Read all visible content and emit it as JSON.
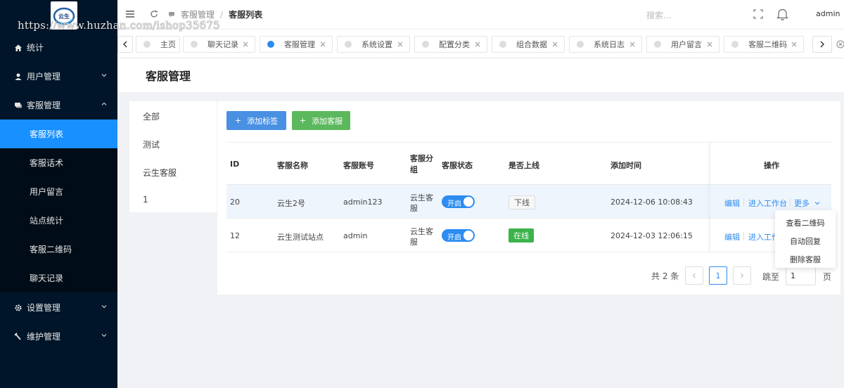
{
  "watermark": "https://www.huzhan.com/ishop35675",
  "logo_text": "云生",
  "sidebar": {
    "items": [
      {
        "label": "统计",
        "icon": "home-icon"
      },
      {
        "label": "用户管理",
        "icon": "user-icon",
        "expanded": false
      },
      {
        "label": "客服管理",
        "icon": "chat-icon",
        "expanded": true,
        "children": [
          {
            "label": "客服列表",
            "active": true
          },
          {
            "label": "客服话术"
          },
          {
            "label": "用户留言"
          },
          {
            "label": "站点统计"
          },
          {
            "label": "客服二维码"
          },
          {
            "label": "聊天记录"
          }
        ]
      },
      {
        "label": "设置管理",
        "icon": "gear-icon",
        "expanded": false
      },
      {
        "label": "维护管理",
        "icon": "wrench-icon",
        "expanded": false
      }
    ]
  },
  "topbar": {
    "breadcrumb": [
      "客服管理",
      "客服列表"
    ],
    "search_placeholder": "搜索...",
    "user": "admin"
  },
  "tabs": [
    {
      "label": "主页",
      "closable": false
    },
    {
      "label": "聊天记录",
      "closable": true
    },
    {
      "label": "客服管理",
      "closable": true,
      "active": true
    },
    {
      "label": "系统设置",
      "closable": true
    },
    {
      "label": "配置分类",
      "closable": true
    },
    {
      "label": "组合数据",
      "closable": true
    },
    {
      "label": "系统日志",
      "closable": true
    },
    {
      "label": "用户留言",
      "closable": true
    },
    {
      "label": "客服二维码",
      "closable": true
    }
  ],
  "page_title": "客服管理",
  "groups": [
    "全部",
    "测试",
    "云生客服",
    "1"
  ],
  "buttons": {
    "add_tag": "添加标签",
    "add_service": "添加客服"
  },
  "table": {
    "headers": [
      "ID",
      "客服名称",
      "客服账号",
      "客服分组",
      "客服状态",
      "是否上线",
      "添加时间",
      "操作"
    ],
    "rows": [
      {
        "id": "20",
        "name": "云生2号",
        "account": "admin123",
        "group_l1": "云生客",
        "group_l2": "服",
        "status": "开启",
        "online": "下线",
        "online_state": false,
        "time": "2024-12-06 10:08:43"
      },
      {
        "id": "12",
        "name": "云生测试站点",
        "account": "admin",
        "group_l1": "云生客",
        "group_l2": "服",
        "status": "开启",
        "online": "在线",
        "online_state": true,
        "time": "2024-12-03 12:06:15"
      }
    ],
    "actions": {
      "edit": "编辑",
      "workbench": "进入工作台",
      "workbench_cut": "进入工作",
      "more": "更多"
    }
  },
  "dropdown": [
    "查看二维码",
    "自动回复",
    "删除客服"
  ],
  "pagination": {
    "total_text": "共 2 条",
    "current": "1",
    "jump_label": "跳至",
    "jump_value": "1",
    "page_suffix": "页"
  },
  "colors": {
    "sidebar_bg": "#001529",
    "active_blue": "#1890ff",
    "primary": "#2d8cf0",
    "green": "#5cb85c",
    "online_green": "#3bb34a"
  }
}
